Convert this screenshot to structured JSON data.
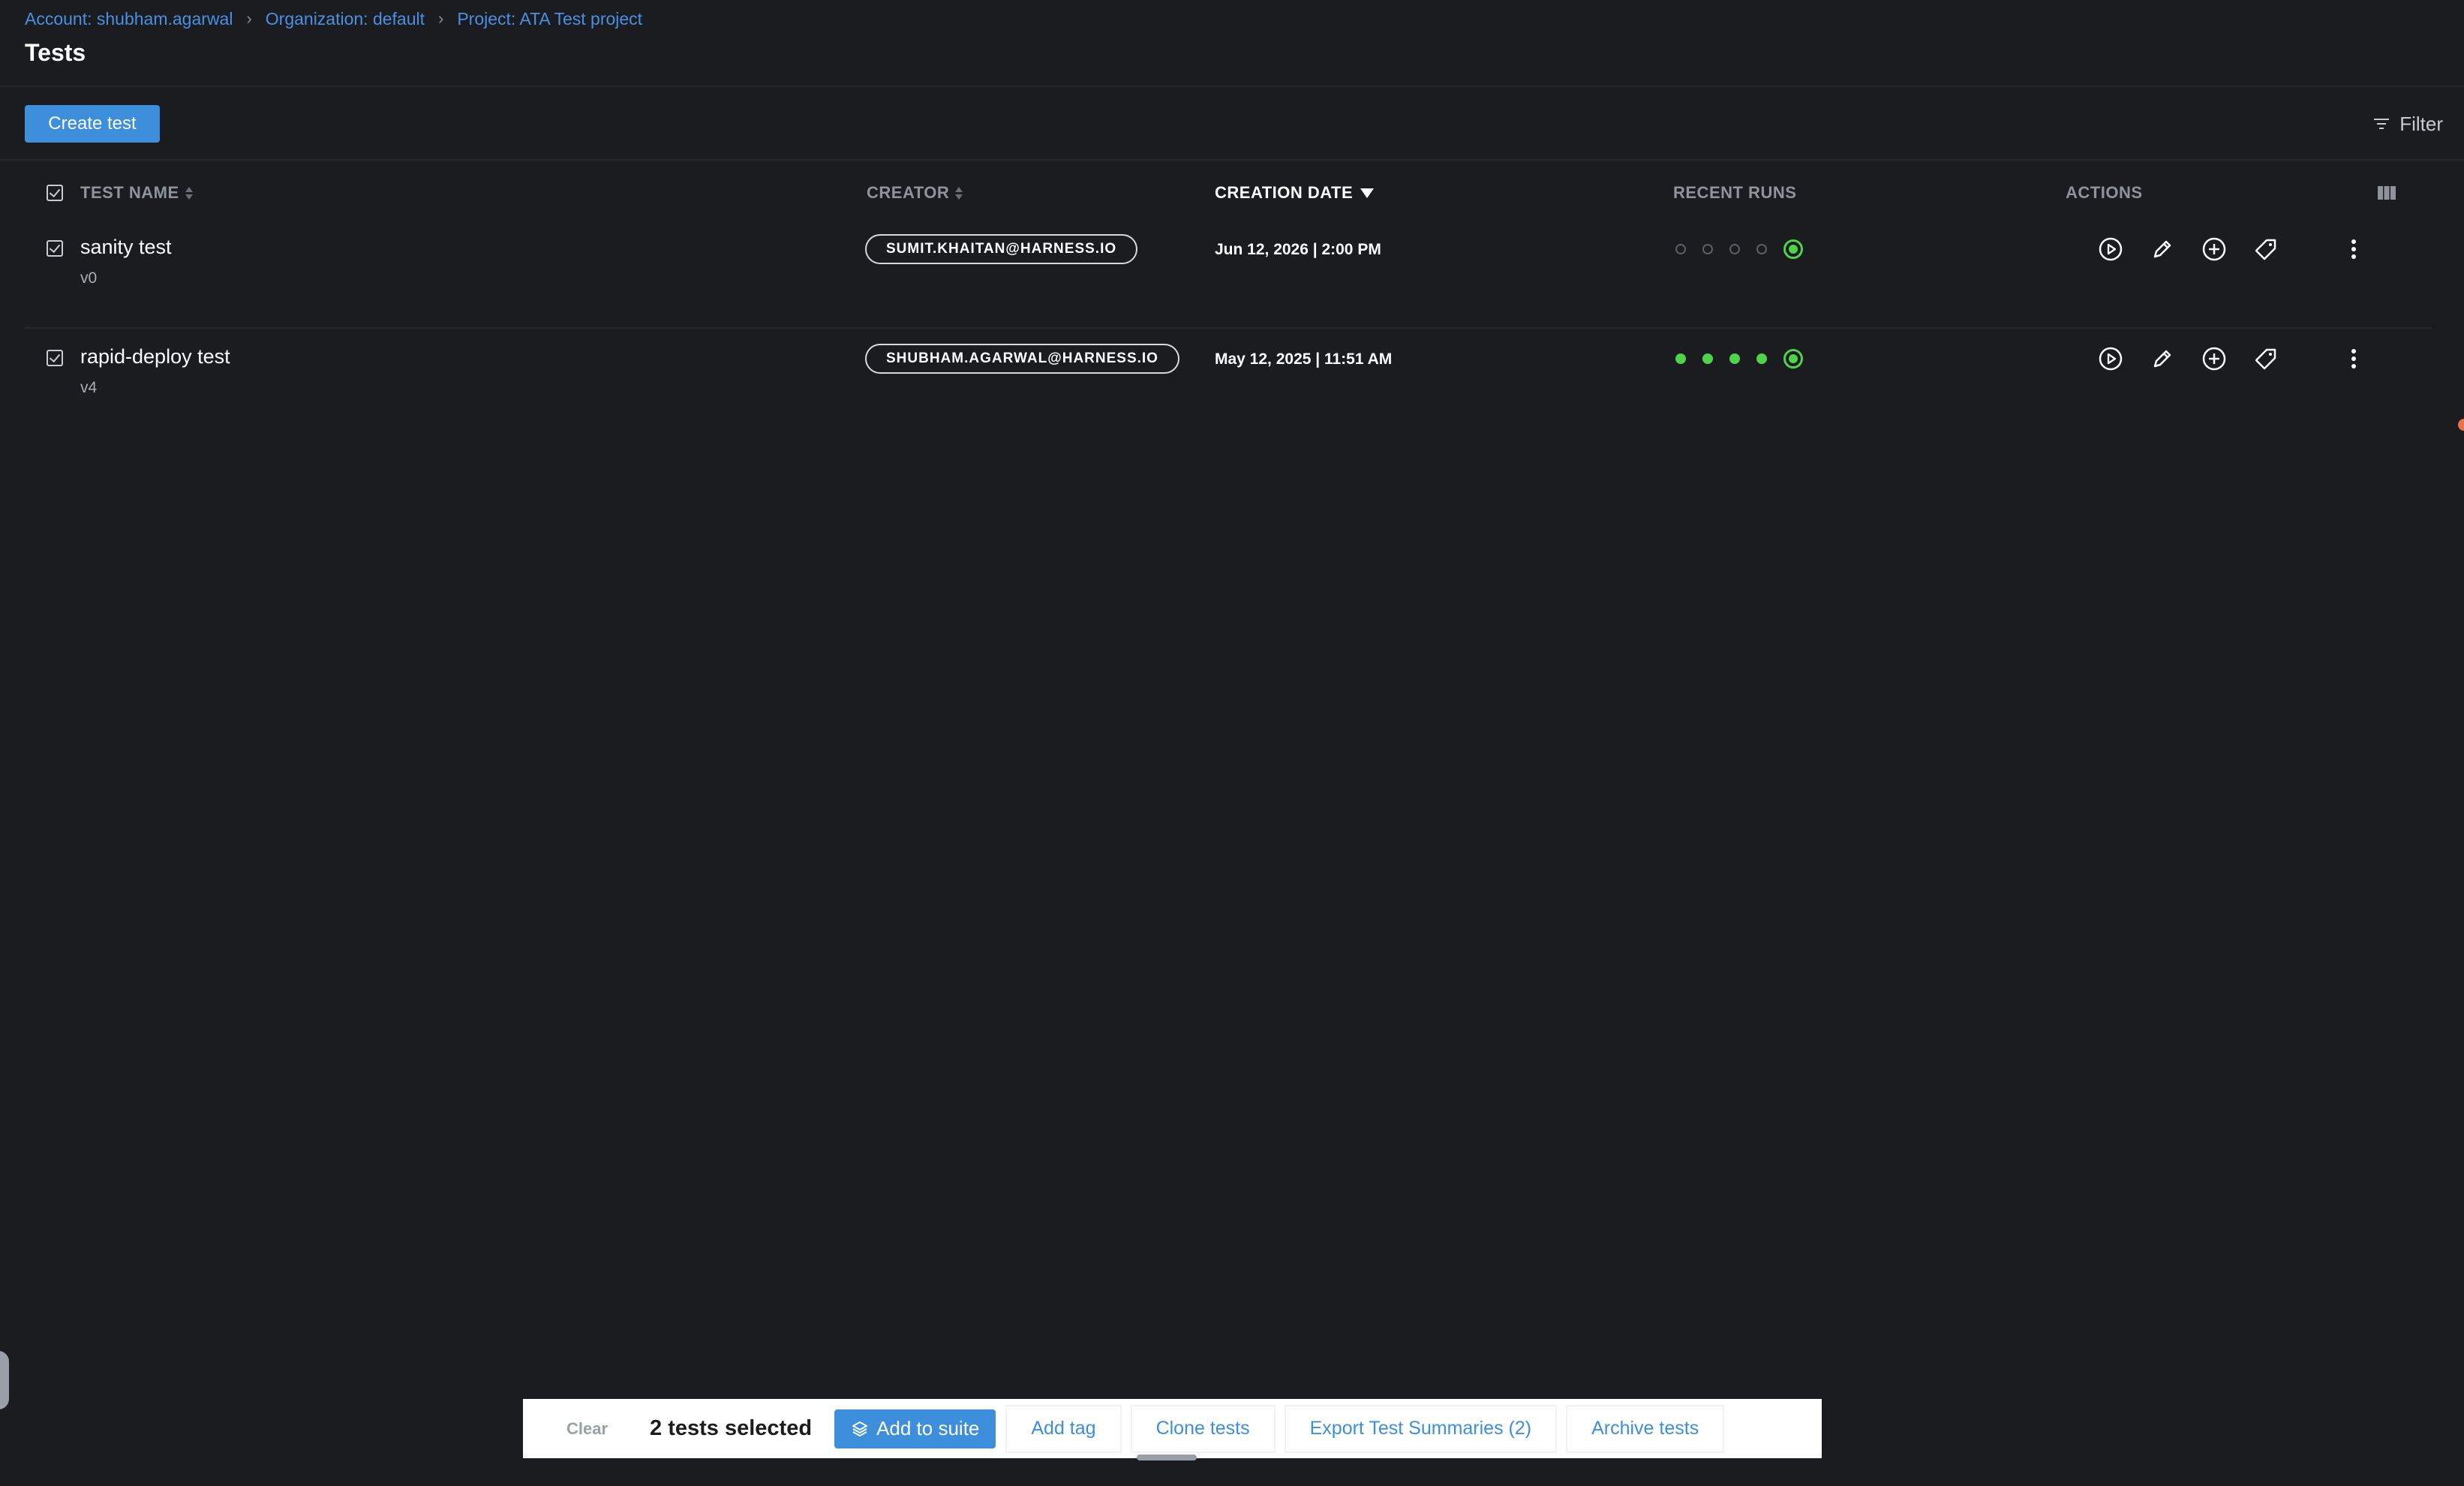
{
  "breadcrumb": [
    {
      "label": "Account: shubham.agarwal"
    },
    {
      "label": "Organization: default"
    },
    {
      "label": "Project: ATA Test project"
    }
  ],
  "page_title": "Tests",
  "toolbar": {
    "create_label": "Create test",
    "filter_label": "Filter"
  },
  "columns": {
    "name": "TEST NAME",
    "creator": "CREATOR",
    "date": "CREATION DATE",
    "runs": "RECENT RUNS",
    "actions": "ACTIONS"
  },
  "rows": [
    {
      "name": "sanity test",
      "version": "v0",
      "creator": "SUMIT.KHAITAN@HARNESS.IO",
      "date": "Jun 12, 2026 | 2:00 PM",
      "runs": [
        "none",
        "none",
        "none",
        "none",
        "pass"
      ]
    },
    {
      "name": "rapid-deploy test",
      "version": "v4",
      "creator": "SHUBHAM.AGARWAL@HARNESS.IO",
      "date": "May 12, 2025 | 11:51 AM",
      "runs": [
        "pass",
        "pass",
        "pass",
        "pass",
        "pass"
      ]
    }
  ],
  "bulk": {
    "clear": "Clear",
    "selected": "2 tests selected",
    "add_suite": "Add to suite",
    "add_tag": "Add tag",
    "clone": "Clone tests",
    "export": "Export Test Summaries (2)",
    "archive": "Archive tests"
  },
  "colors": {
    "accent": "#3d8fdb",
    "pass": "#4fd34b",
    "background": "#1b1c20"
  }
}
